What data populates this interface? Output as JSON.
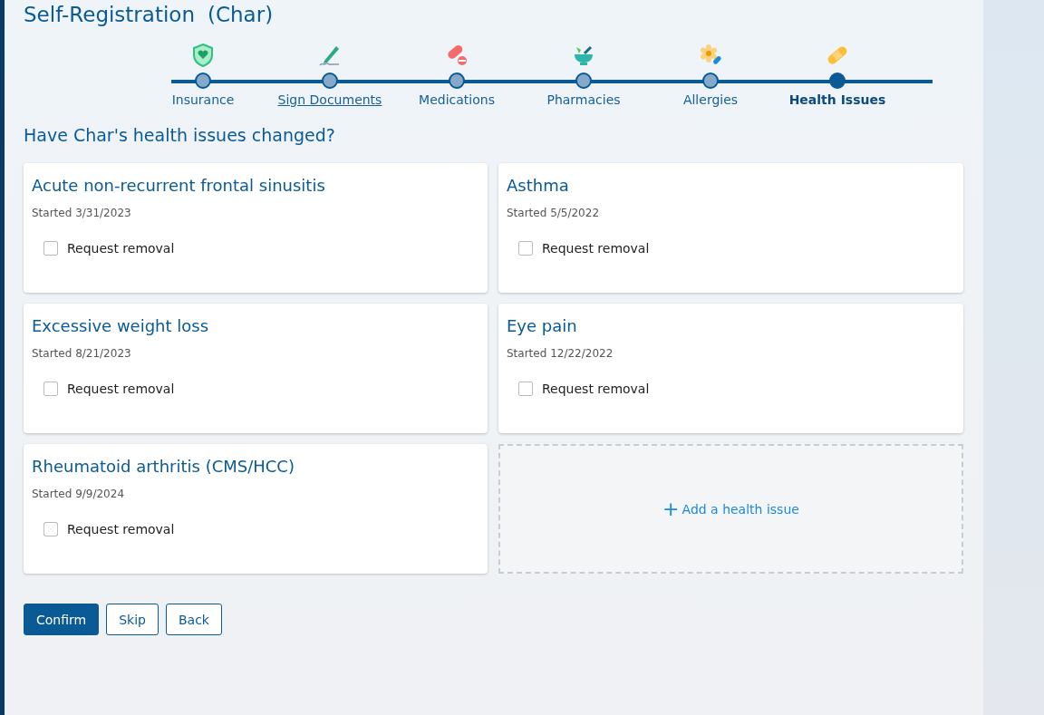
{
  "header": {
    "title": "Self-Registration",
    "subtitle": "(Char)"
  },
  "steps": [
    {
      "label": "Insurance",
      "kind": "shield",
      "selected": false,
      "underlined": false
    },
    {
      "label": "Sign Documents",
      "kind": "pen",
      "selected": false,
      "underlined": true
    },
    {
      "label": "Medications",
      "kind": "pills",
      "selected": false,
      "underlined": false
    },
    {
      "label": "Pharmacies",
      "kind": "mortar",
      "selected": false,
      "underlined": false
    },
    {
      "label": "Allergies",
      "kind": "flower",
      "selected": false,
      "underlined": false
    },
    {
      "label": "Health Issues",
      "kind": "bandage",
      "selected": true,
      "underlined": false
    }
  ],
  "question": "Have Char's health issues changed?",
  "issues": [
    {
      "name": "Acute non-recurrent frontal sinusitis",
      "started": "Started 3/31/2023",
      "checkbox_label": "Request removal",
      "checked": false
    },
    {
      "name": "Asthma",
      "started": "Started 5/5/2022",
      "checkbox_label": "Request removal",
      "checked": false
    },
    {
      "name": "Excessive weight loss",
      "started": "Started 8/21/2023",
      "checkbox_label": "Request removal",
      "checked": false
    },
    {
      "name": "Eye pain",
      "started": "Started 12/22/2022",
      "checkbox_label": "Request removal",
      "checked": false
    },
    {
      "name": "Rheumatoid arthritis (CMS/HCC)",
      "started": "Started 9/9/2024",
      "checkbox_label": "Request removal",
      "checked": false
    }
  ],
  "add_button": {
    "icon": "+",
    "label": "Add a health issue"
  },
  "buttons": [
    {
      "label": "Confirm",
      "kind": "primary"
    },
    {
      "label": "Skip",
      "kind": "secondary"
    },
    {
      "label": "Back",
      "kind": "secondary"
    }
  ]
}
